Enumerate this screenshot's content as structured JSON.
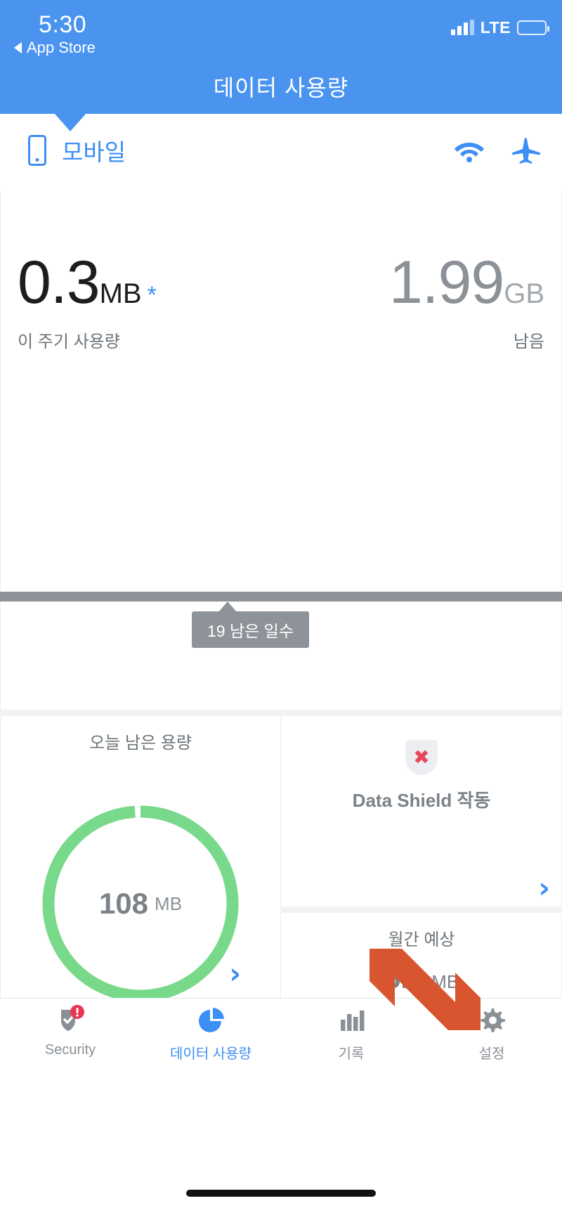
{
  "status_bar": {
    "time": "5:30",
    "back_label": "App Store",
    "network": "LTE",
    "signal_icon": "signal-bars-icon",
    "battery_icon": "battery-icon"
  },
  "header": {
    "title": "데이터 사용량"
  },
  "segment": {
    "device_label": "모바일",
    "device_icon": "phone-icon",
    "wifi_icon": "wifi-icon",
    "airplane_icon": "airplane-icon"
  },
  "usage": {
    "used_value": "0.3",
    "used_unit": "MB",
    "used_star": "*",
    "used_label": "이 주기 사용량",
    "remaining_value": "1.99",
    "remaining_unit": "GB",
    "remaining_label": "남음"
  },
  "progress": {
    "percent": 0.015,
    "tooltip": "19 남은 일수"
  },
  "cards": {
    "today": {
      "title": "오늘 남은 용량",
      "value": "108",
      "unit": "MB",
      "ring_percent": 99,
      "ring_color": "#79d98a",
      "chevron_icon": "chevron-right-icon"
    },
    "data_shield": {
      "label": "Data Shield 작동",
      "icon": "shield-x-icon",
      "icon_mark_color": "#e8465b",
      "chevron_icon": "chevron-right-icon"
    },
    "forecast": {
      "title": "월간 예상",
      "value": "5.3",
      "unit": "MB"
    }
  },
  "annotation": {
    "arrow_icon": "orange-arrow-icon",
    "arrow_color": "#d9552f"
  },
  "tabs": [
    {
      "label": "Security",
      "icon": "shield-alert-icon",
      "active": false,
      "badge": "!"
    },
    {
      "label": "데이터 사용량",
      "icon": "pie-chart-icon",
      "active": true
    },
    {
      "label": "기록",
      "icon": "bar-chart-icon",
      "active": false
    },
    {
      "label": "설정",
      "icon": "gear-icon",
      "active": false
    }
  ],
  "colors": {
    "accent": "#4a94f0",
    "ring": "#79d98a",
    "muted": "#8d9399",
    "danger": "#e8465b",
    "arrow": "#d9552f"
  }
}
